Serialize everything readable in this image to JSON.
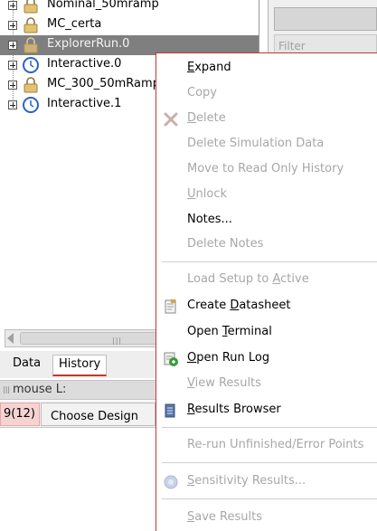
{
  "tree": {
    "items": [
      {
        "label": "Nominal_50mramp",
        "icon": "lock-icon",
        "selected": false
      },
      {
        "label": "MC_certa",
        "icon": "lock-icon",
        "selected": false
      },
      {
        "label": "ExplorerRun.0",
        "icon": "lock-icon",
        "selected": true
      },
      {
        "label": "Interactive.0",
        "icon": "clock-icon",
        "selected": false
      },
      {
        "label": "MC_300_50mRamp",
        "icon": "lock-icon",
        "selected": false
      },
      {
        "label": "Interactive.1",
        "icon": "clock-icon",
        "selected": false
      }
    ]
  },
  "right_panel": {
    "filter_placeholder": "Filter"
  },
  "tabs": {
    "data": "Data",
    "history": "History"
  },
  "mouse_row": {
    "label": "mouse L:"
  },
  "status": {
    "count": "9(12)",
    "choose_design": "Choose Design"
  },
  "menu": {
    "items": [
      {
        "label": "Expand",
        "mnemonic": "E",
        "enabled": true
      },
      {
        "label": "Copy",
        "enabled": false
      },
      {
        "label": "Delete",
        "mnemonic": "D",
        "enabled": false,
        "icon": "delete-x-icon"
      },
      {
        "label": "Delete Simulation Data",
        "enabled": false
      },
      {
        "label": "Move to Read Only History",
        "enabled": false
      },
      {
        "label": "Unlock",
        "mnemonic": "U",
        "enabled": false
      },
      {
        "label": "Notes...",
        "enabled": true
      },
      {
        "label": "Delete Notes",
        "enabled": false
      },
      {
        "label": "Load Setup to Active",
        "mnemonic": "A",
        "enabled": false
      },
      {
        "label": "Create Datasheet",
        "mnemonic": "D",
        "enabled": true,
        "icon": "datasheet-icon"
      },
      {
        "label": "Open Terminal",
        "mnemonic": "T",
        "enabled": true
      },
      {
        "label": "Open Run Log",
        "mnemonic": "O",
        "enabled": true,
        "icon": "run-log-icon"
      },
      {
        "label": "View Results",
        "mnemonic": "V",
        "enabled": false
      },
      {
        "label": "Results Browser",
        "mnemonic": "R",
        "enabled": true,
        "icon": "results-browser-icon"
      },
      {
        "label": "Re-run Unfinished/Error Points",
        "enabled": false
      },
      {
        "label": "Sensitivity Results...",
        "mnemonic": "S",
        "enabled": false,
        "icon": "sensitivity-icon"
      },
      {
        "label": "Save Results",
        "mnemonic": "S",
        "enabled": false
      }
    ]
  },
  "colors": {
    "menu_border": "#c0392b",
    "selection": "#7f7f7f",
    "disabled_text": "#a7a7a7",
    "tab_underline": "#c0392b",
    "status_count_bg": "#f6d3d3"
  }
}
